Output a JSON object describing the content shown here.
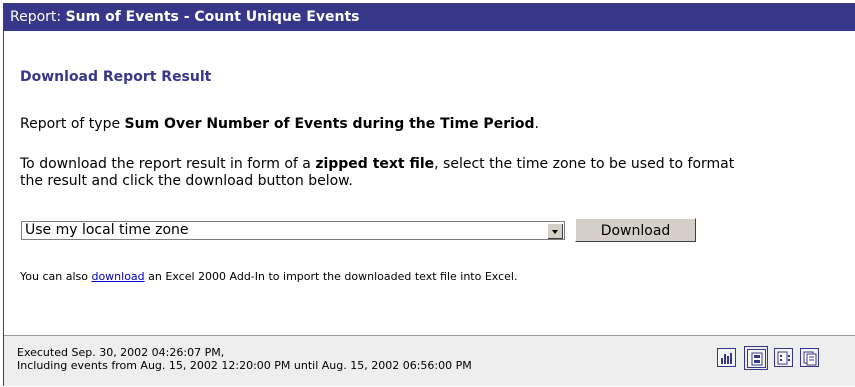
{
  "titlebar": {
    "prefix": "Report: ",
    "name": "Sum of Events - Count Unique Events"
  },
  "section_title": "Download Report Result",
  "report_type": {
    "prefix": "Report of type ",
    "bold": "Sum Over Number of Events during the Time Period",
    "suffix": "."
  },
  "instructions": {
    "part1": "To download the report result in form of a ",
    "bold": "zipped text file",
    "part2": ", select the time zone to be used to format",
    "line2": "the result and click the download button below."
  },
  "timezone_select": {
    "selected": "Use my local time zone"
  },
  "download_button": "Download",
  "addin_note": {
    "prefix": "You can also ",
    "link": "download",
    "suffix": " an Excel 2000 Add-In to import the downloaded text file into Excel."
  },
  "footer": {
    "executed": "Executed Sep. 30, 2002 04:26:07 PM,",
    "range": "Including events from Aug. 15, 2002 12:20:00 PM until Aug. 15, 2002 06:56:00 PM"
  },
  "toolbar_icons": [
    "bar-chart-icon",
    "download-file-icon",
    "details-list-icon",
    "copy-pages-icon"
  ],
  "colors": {
    "header": "#37378a",
    "link": "#0000cc",
    "footer_bg": "#eeeeee"
  }
}
